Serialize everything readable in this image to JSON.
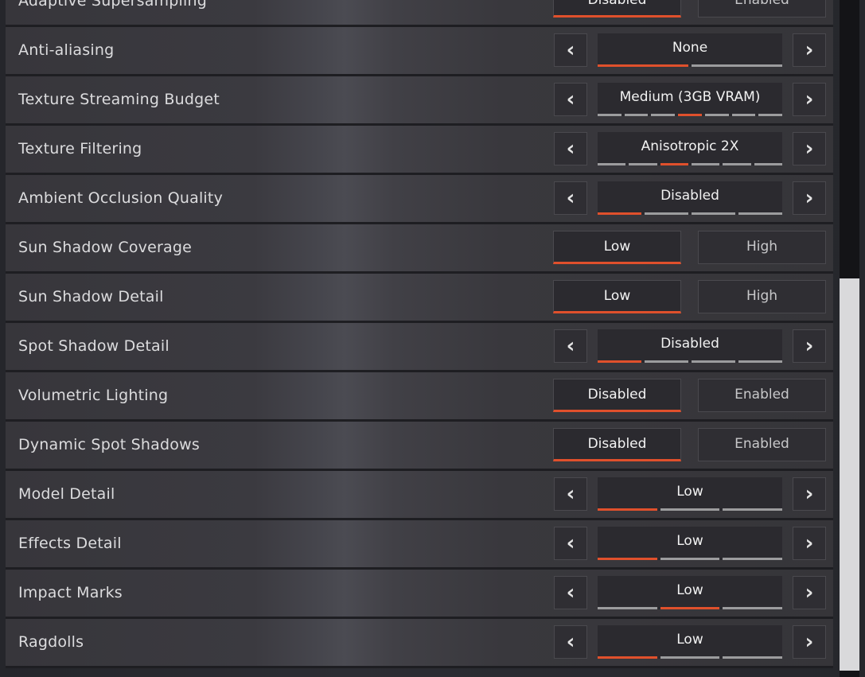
{
  "accent_color": "#e0502c",
  "rows": [
    {
      "label": "Adaptive Supersampling",
      "type": "toggle",
      "options": [
        "Disabled",
        "Enabled"
      ],
      "selected": 0
    },
    {
      "label": "Anti-aliasing",
      "type": "stepper",
      "value": "None",
      "levels": 2,
      "selected": 0
    },
    {
      "label": "Texture Streaming Budget",
      "type": "stepper",
      "value": "Medium (3GB VRAM)",
      "levels": 7,
      "selected": 3
    },
    {
      "label": "Texture Filtering",
      "type": "stepper",
      "value": "Anisotropic 2X",
      "levels": 6,
      "selected": 2
    },
    {
      "label": "Ambient Occlusion Quality",
      "type": "stepper",
      "value": "Disabled",
      "levels": 4,
      "selected": 0
    },
    {
      "label": "Sun Shadow Coverage",
      "type": "toggle",
      "options": [
        "Low",
        "High"
      ],
      "selected": 0
    },
    {
      "label": "Sun Shadow Detail",
      "type": "toggle",
      "options": [
        "Low",
        "High"
      ],
      "selected": 0
    },
    {
      "label": "Spot Shadow Detail",
      "type": "stepper",
      "value": "Disabled",
      "levels": 4,
      "selected": 0
    },
    {
      "label": "Volumetric Lighting",
      "type": "toggle",
      "options": [
        "Disabled",
        "Enabled"
      ],
      "selected": 0
    },
    {
      "label": "Dynamic Spot Shadows",
      "type": "toggle",
      "options": [
        "Disabled",
        "Enabled"
      ],
      "selected": 0
    },
    {
      "label": "Model Detail",
      "type": "stepper",
      "value": "Low",
      "levels": 3,
      "selected": 0
    },
    {
      "label": "Effects Detail",
      "type": "stepper",
      "value": "Low",
      "levels": 3,
      "selected": 0
    },
    {
      "label": "Impact Marks",
      "type": "stepper",
      "value": "Low",
      "levels": 3,
      "selected": 1
    },
    {
      "label": "Ragdolls",
      "type": "stepper",
      "value": "Low",
      "levels": 3,
      "selected": 0
    }
  ],
  "icons": {
    "prev": "‹",
    "next": "›"
  },
  "scrollbar": {
    "position_fraction": 0.42
  }
}
